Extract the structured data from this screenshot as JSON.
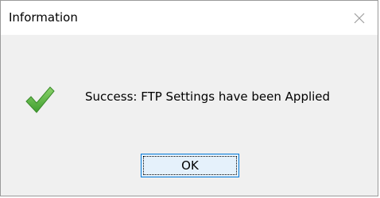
{
  "window": {
    "title": "Information"
  },
  "icons": {
    "close": "close-icon",
    "status": "success-check-icon"
  },
  "message": {
    "text": "Success: FTP Settings have been Applied"
  },
  "buttons": {
    "ok_label": "OK"
  },
  "colors": {
    "check_green": "#5cb85c",
    "button_border": "#0078d7",
    "button_fill": "#e5f1fb",
    "dialog_background": "#f0f0f0"
  }
}
